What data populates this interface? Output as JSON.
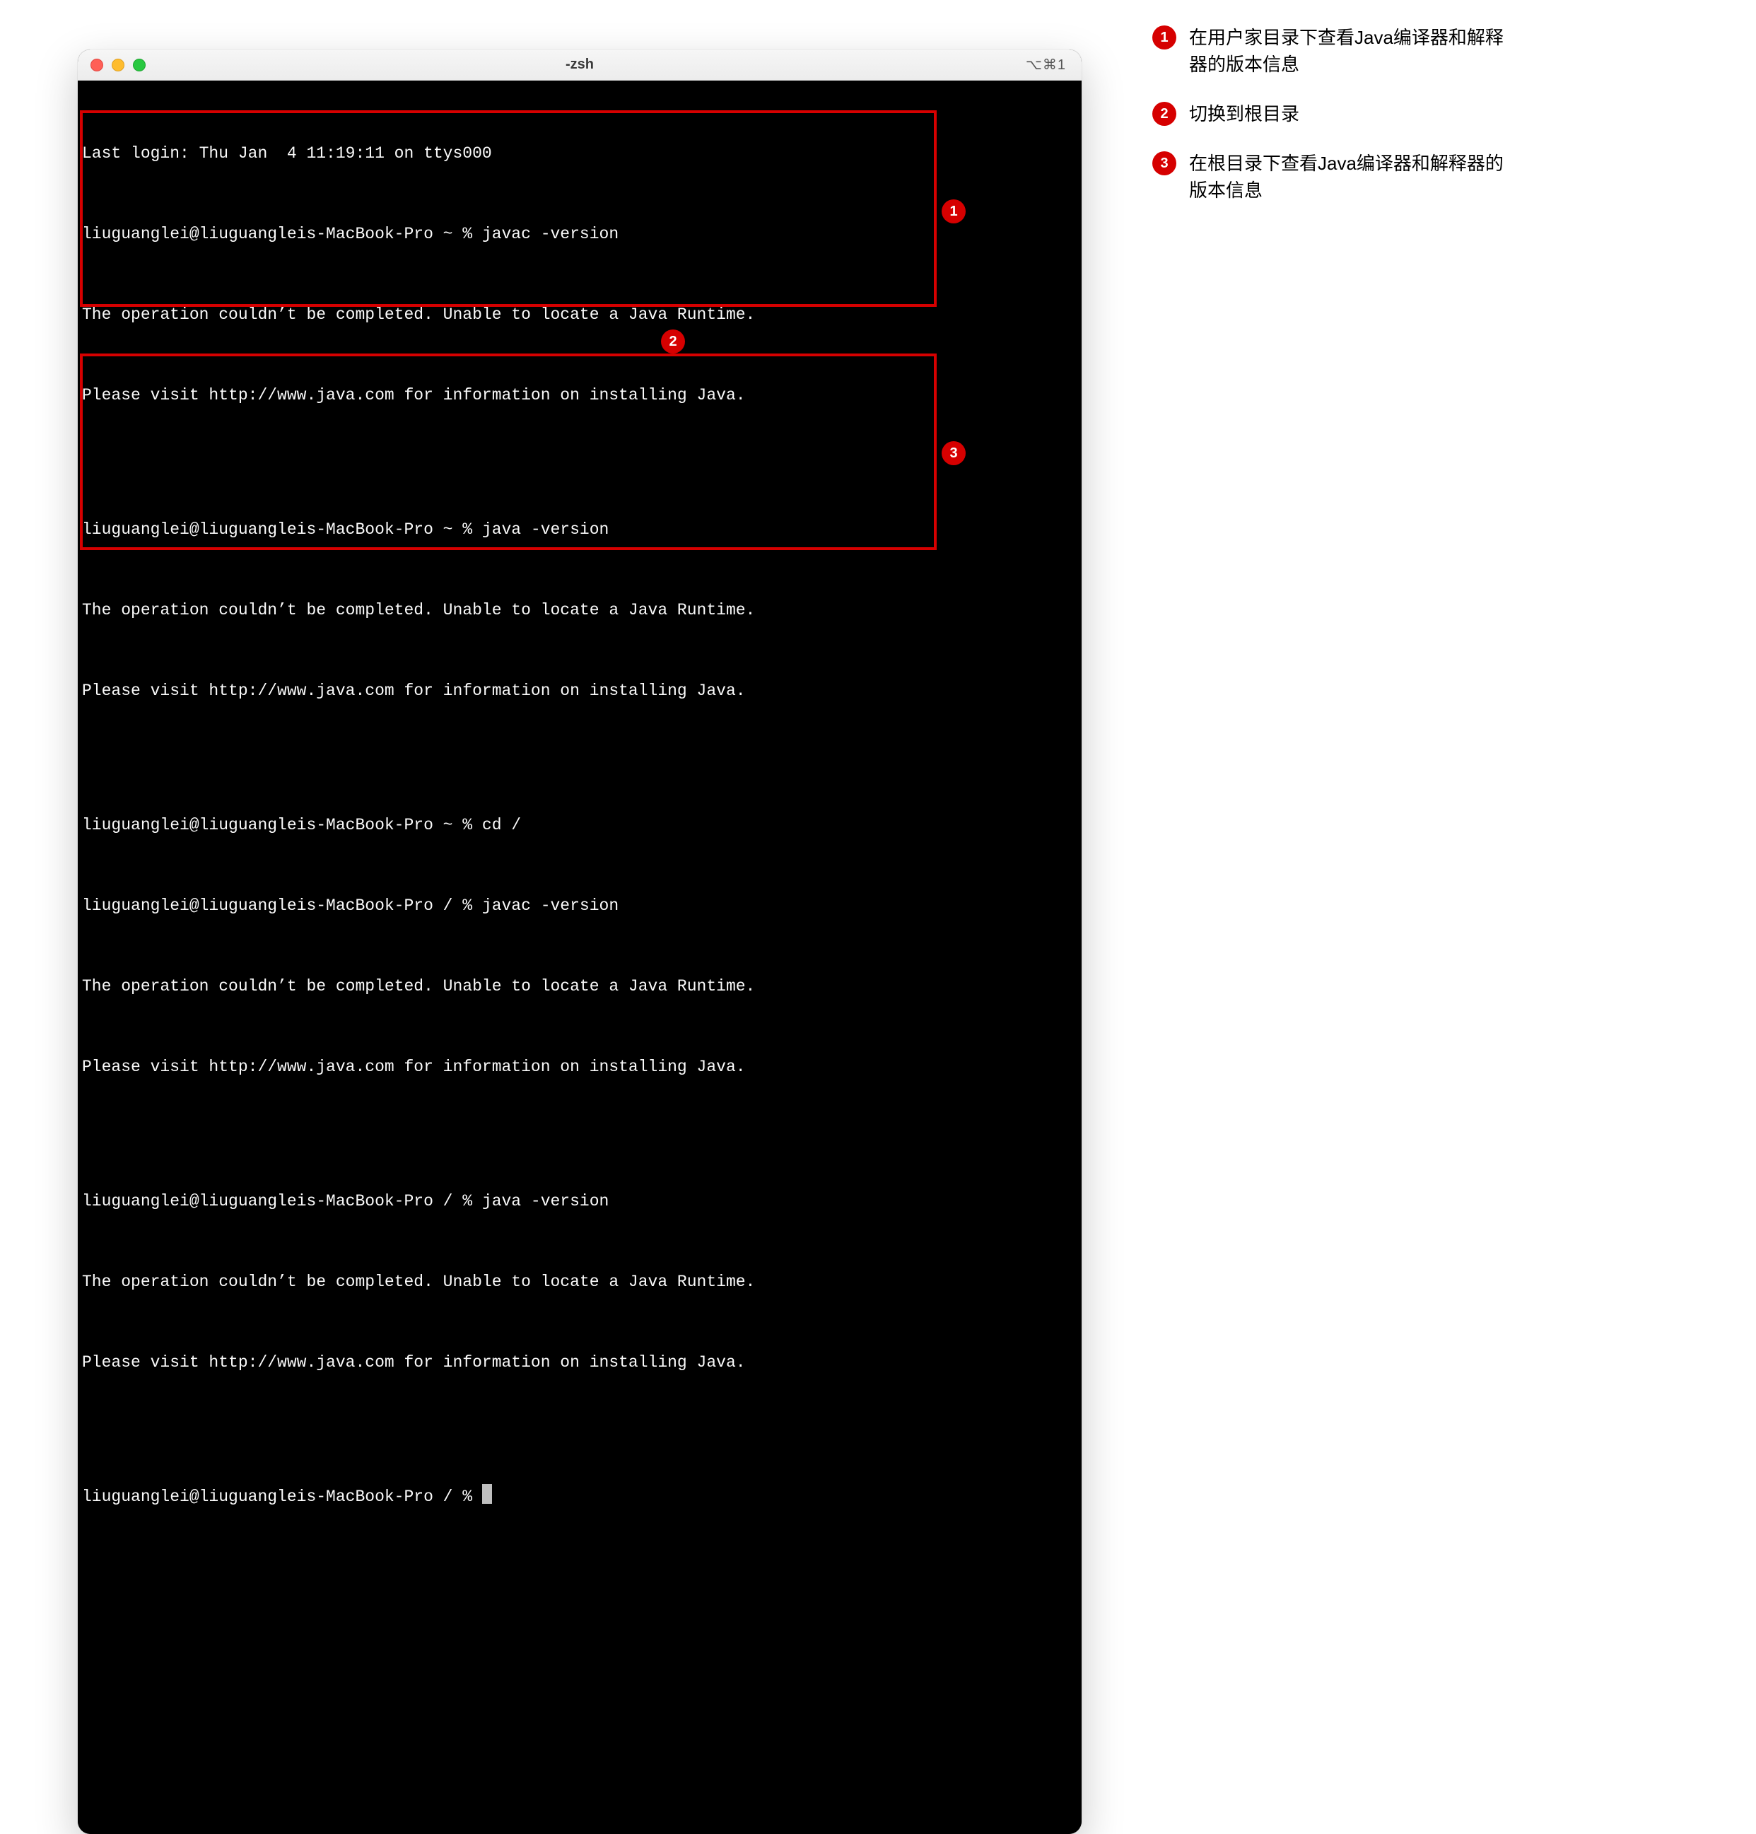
{
  "window": {
    "title": "-zsh",
    "shortcut": "⌥⌘1"
  },
  "terminal": {
    "lines": [
      "Last login: Thu Jan  4 11:19:11 on ttys000",
      "liuguanglei@liuguangleis-MacBook-Pro ~ % javac -version",
      "The operation couldn’t be completed. Unable to locate a Java Runtime.",
      "Please visit http://www.java.com for information on installing Java.",
      "",
      "liuguanglei@liuguangleis-MacBook-Pro ~ % java -version",
      "The operation couldn’t be completed. Unable to locate a Java Runtime.",
      "Please visit http://www.java.com for information on installing Java.",
      "",
      "liuguanglei@liuguangleis-MacBook-Pro ~ % cd /",
      "liuguanglei@liuguangleis-MacBook-Pro / % javac -version",
      "The operation couldn’t be completed. Unable to locate a Java Runtime.",
      "Please visit http://www.java.com for information on installing Java.",
      "",
      "liuguanglei@liuguangleis-MacBook-Pro / % java -version",
      "The operation couldn’t be completed. Unable to locate a Java Runtime.",
      "Please visit http://www.java.com for information on installing Java.",
      "",
      "liuguanglei@liuguangleis-MacBook-Pro / % "
    ]
  },
  "annotations": {
    "badges": {
      "1": "1",
      "2": "2",
      "3": "3"
    }
  },
  "legend": {
    "items": [
      {
        "num": "1",
        "text": "在用户家目录下查看Java编译器和解释器的版本信息"
      },
      {
        "num": "2",
        "text": "切换到根目录"
      },
      {
        "num": "3",
        "text": "在根目录下查看Java编译器和解释器的版本信息"
      }
    ]
  }
}
